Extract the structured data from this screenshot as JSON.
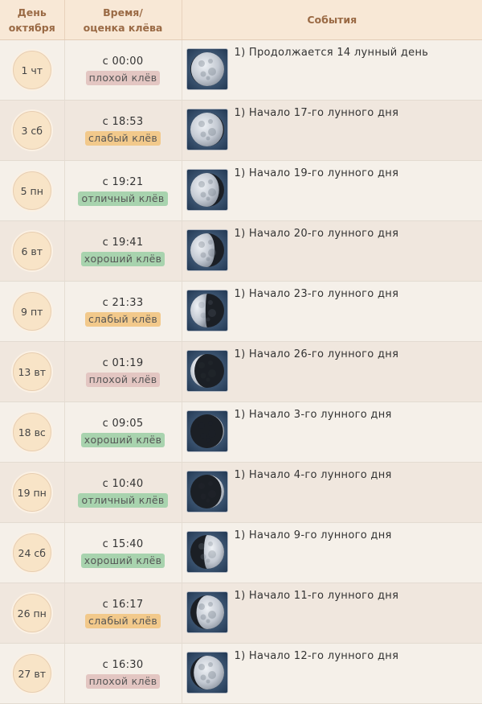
{
  "header": {
    "day_line1": "День",
    "day_line2": "октября",
    "time_line1": "Время/",
    "time_line2": "оценка клёва",
    "events": "События"
  },
  "rows": [
    {
      "day": "1 чт",
      "time": "с 00:00",
      "rating": "плохой клёв",
      "rating_class": "bad",
      "event": "1) Продолжается 14 лунный день",
      "moon_lit": 0.98,
      "waxing": true
    },
    {
      "day": "3 сб",
      "time": "с 18:53",
      "rating": "слабый клёв",
      "rating_class": "weak",
      "event": "1) Начало 17-го лунного дня",
      "moon_lit": 0.97,
      "waxing": false
    },
    {
      "day": "5 пн",
      "time": "с 19:21",
      "rating": "отличный клёв",
      "rating_class": "excellent",
      "event": "1) Начало 19-го лунного дня",
      "moon_lit": 0.85,
      "waxing": false
    },
    {
      "day": "6 вт",
      "time": "с 19:41",
      "rating": "хороший клёв",
      "rating_class": "good",
      "event": "1) Начало 20-го лунного дня",
      "moon_lit": 0.72,
      "waxing": false
    },
    {
      "day": "9 пт",
      "time": "с 21:33",
      "rating": "слабый клёв",
      "rating_class": "weak",
      "event": "1) Начало 23-го лунного дня",
      "moon_lit": 0.45,
      "waxing": false
    },
    {
      "day": "13 вт",
      "time": "с 01:19",
      "rating": "плохой клёв",
      "rating_class": "bad",
      "event": "1) Начало 26-го лунного дня",
      "moon_lit": 0.12,
      "waxing": false
    },
    {
      "day": "18 вс",
      "time": "с 09:05",
      "rating": "хороший клёв",
      "rating_class": "good",
      "event": "1) Начало 3-го лунного дня",
      "moon_lit": 0.03,
      "waxing": true
    },
    {
      "day": "19 пн",
      "time": "с 10:40",
      "rating": "отличный клёв",
      "rating_class": "excellent",
      "event": "1) Начало 4-го лунного дня",
      "moon_lit": 0.08,
      "waxing": true
    },
    {
      "day": "24 сб",
      "time": "с 15:40",
      "rating": "хороший клёв",
      "rating_class": "good",
      "event": "1) Начало 9-го лунного дня",
      "moon_lit": 0.6,
      "waxing": true
    },
    {
      "day": "26 пн",
      "time": "с 16:17",
      "rating": "слабый клёв",
      "rating_class": "weak",
      "event": "1) Начало 11-го лунного дня",
      "moon_lit": 0.82,
      "waxing": true
    },
    {
      "day": "27 вт",
      "time": "с 16:30",
      "rating": "плохой клёв",
      "rating_class": "bad",
      "event": "1) Начало 12-го лунного дня",
      "moon_lit": 0.9,
      "waxing": true
    }
  ]
}
